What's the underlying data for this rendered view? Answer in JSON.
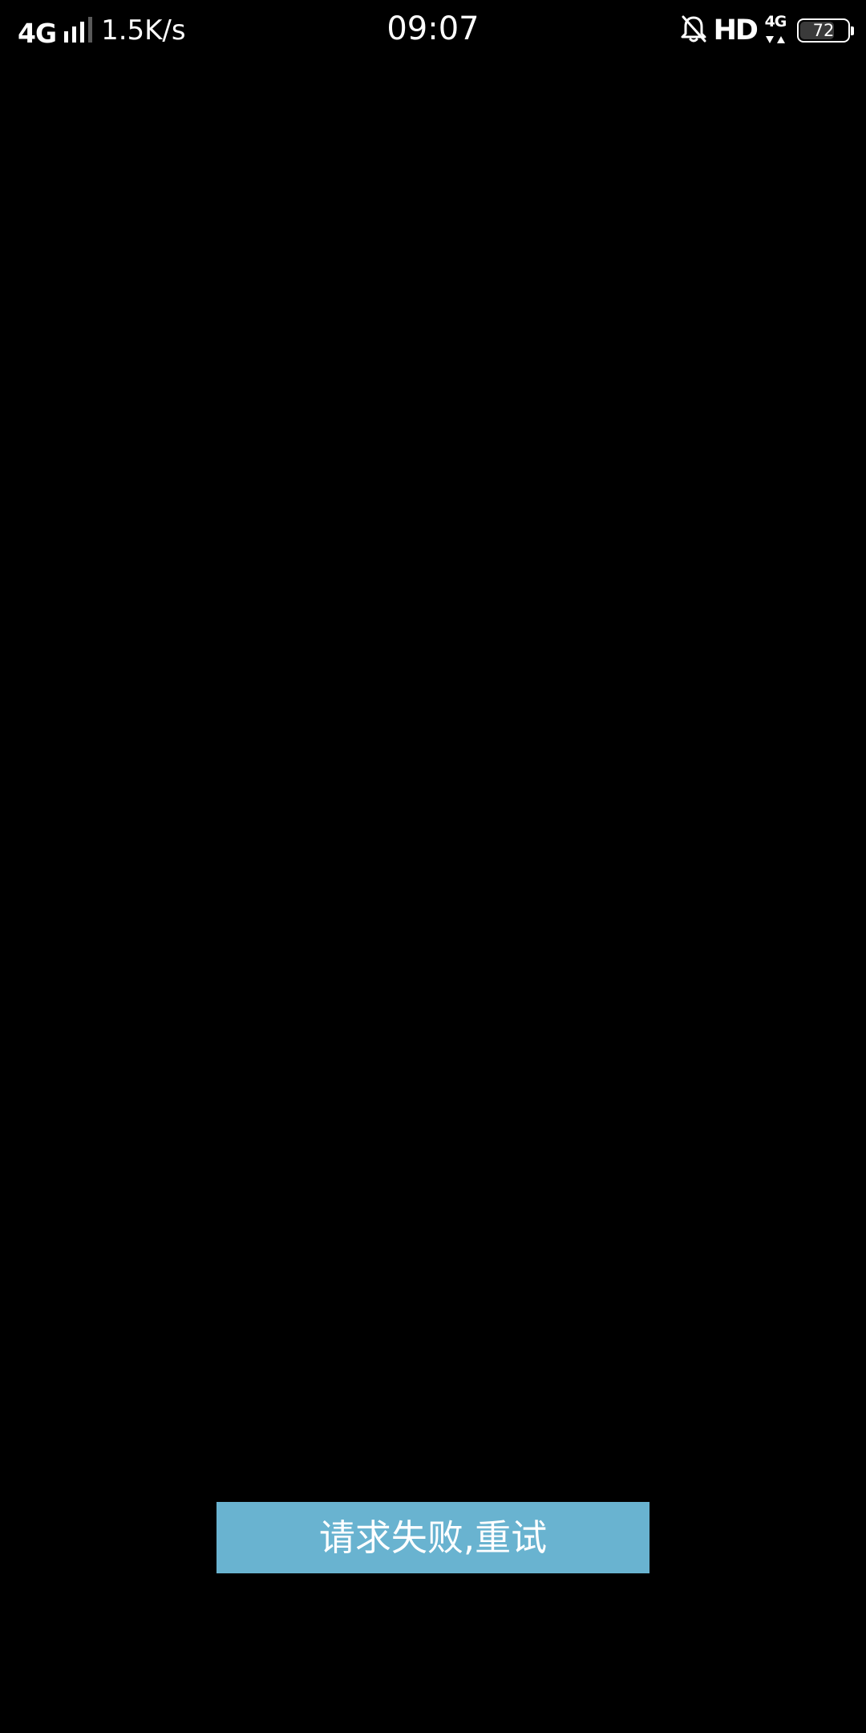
{
  "status_bar": {
    "network_type": "4G",
    "signal_icon": "signal-strength-icon",
    "signal_level": 3,
    "signal_max": 4,
    "net_speed": "1.5K/s",
    "time": "09:07",
    "silent_icon": "bell-off-icon",
    "hd_label": "HD",
    "data_network_label": "4G",
    "data_activity_icon": "data-up-down-icon",
    "battery_icon": "battery-icon",
    "battery_level": "72"
  },
  "main": {
    "retry_label": "请求失败,重试"
  },
  "colors": {
    "background": "#000000",
    "retry_button": "#69b3d0",
    "text": "#ffffff"
  }
}
